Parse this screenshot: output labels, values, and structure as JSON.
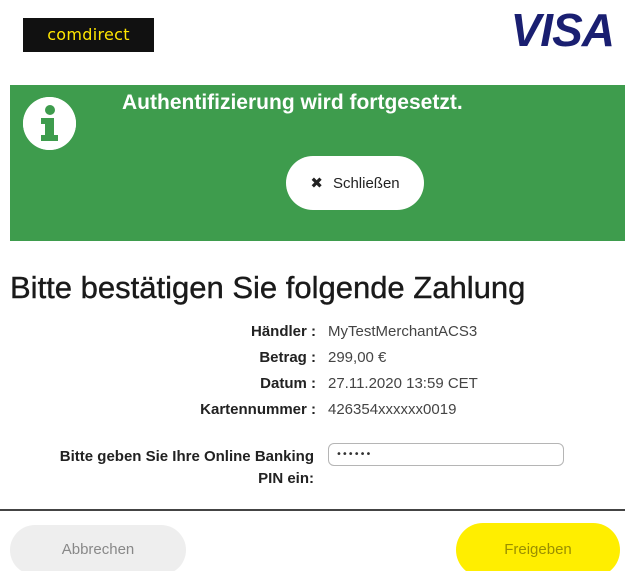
{
  "header": {
    "bank_logo_text": "comdirect",
    "card_brand_logo_text": "VISA"
  },
  "banner": {
    "icon": "info-icon",
    "title": "Authentifizierung wird fortgesetzt.",
    "close_icon": "close-icon",
    "close_label": "Schließen",
    "color": "#3e9c4d"
  },
  "main": {
    "heading": "Bitte bestätigen Sie folgende Zahlung",
    "details": [
      {
        "label": "Händler :",
        "value": "MyTestMerchantACS3"
      },
      {
        "label": "Betrag :",
        "value": "299,00 €"
      },
      {
        "label": "Datum :",
        "value": "27.11.2020 13:59 CET"
      },
      {
        "label": "Kartennummer :",
        "value": "426354xxxxxx0019"
      }
    ],
    "pin": {
      "label": "Bitte geben Sie Ihre Online Banking PIN ein:",
      "value": "••••••"
    }
  },
  "footer": {
    "cancel_label": "Abbrechen",
    "submit_label": "Freigeben",
    "submit_color": "#ffee00"
  }
}
